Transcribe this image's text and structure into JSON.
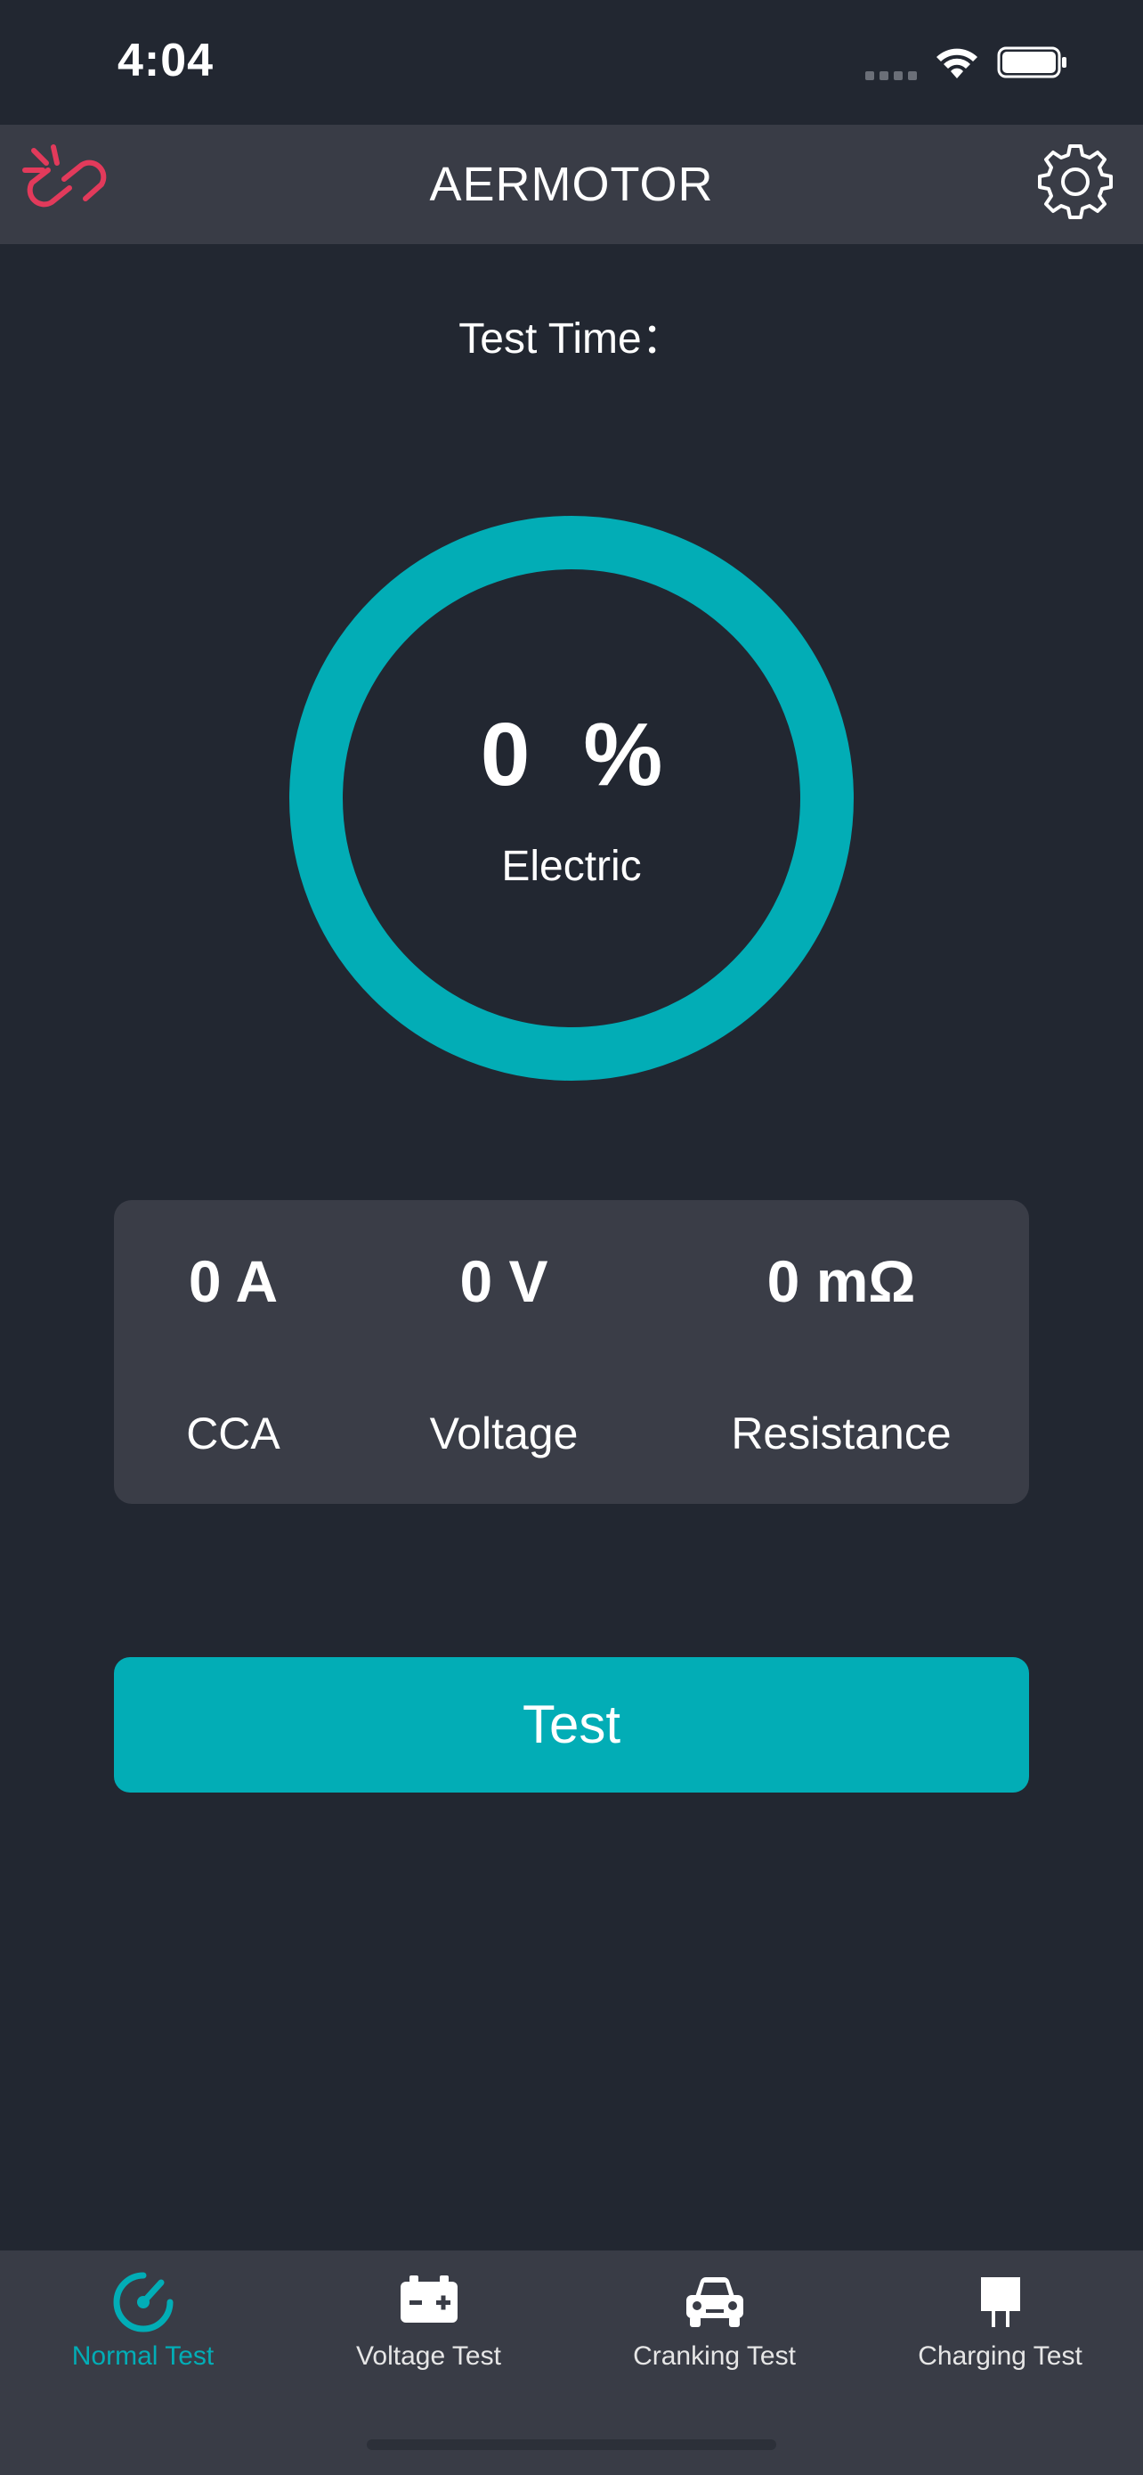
{
  "status_bar": {
    "time": "4:04"
  },
  "header": {
    "title": "AERMOTOR",
    "link_icon": "broken-link-icon",
    "settings_icon": "gear-icon"
  },
  "test_time": {
    "label": "Test Time："
  },
  "gauge": {
    "value": "0",
    "unit": "%",
    "label": "Electric",
    "ring_color": "#02adb6"
  },
  "metrics": [
    {
      "value": "0 A",
      "label": "CCA"
    },
    {
      "value": "0 V",
      "label": "Voltage"
    },
    {
      "value": "0 mΩ",
      "label": "Resistance"
    }
  ],
  "test_button": {
    "label": "Test"
  },
  "tabs": [
    {
      "label": "Normal Test",
      "icon": "speedometer-icon",
      "active": true
    },
    {
      "label": "Voltage Test",
      "icon": "battery-icon",
      "active": false
    },
    {
      "label": "Cranking Test",
      "icon": "car-icon",
      "active": false
    },
    {
      "label": "Charging Test",
      "icon": "charger-icon",
      "active": false
    }
  ],
  "colors": {
    "background": "#222731",
    "panel": "#393c46",
    "accent": "#02adb6",
    "link_icon": "#e23a5b"
  }
}
